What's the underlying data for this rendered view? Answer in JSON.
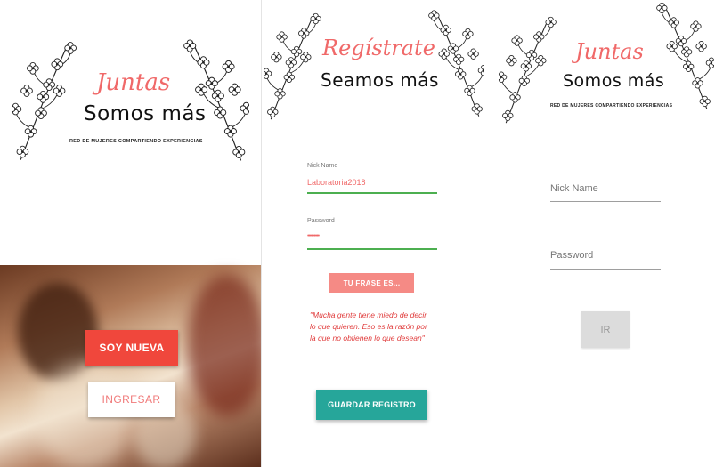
{
  "welcome": {
    "logo_script": "Juntas",
    "logo_main": "Somos más",
    "tagline": "RED DE MUJERES COMPARTIENDO EXPERIENCIAS",
    "new_button": "SOY NUEVA",
    "login_button": "INGRESAR"
  },
  "register": {
    "title_script": "Regístrate",
    "title_main": "Seamos más",
    "nick_label": "Nick Name",
    "nick_value": "Laboratoria2018",
    "password_label": "Password",
    "password_value": "•••••••••",
    "phrase_button": "TU FRASE ES...",
    "quote": "\"Mucha gente tiene miedo de decir lo que quieren. Eso es la razón por la que no obtienen lo que desean\"",
    "save_button": "GUARDAR REGISTRO"
  },
  "login": {
    "logo_script": "Juntas",
    "logo_main": "Somos más",
    "tagline": "RED DE MUJERES COMPARTIENDO EXPERIENCIAS",
    "nick_placeholder": "Nick Name",
    "password_placeholder": "Password",
    "submit_button": "IR"
  },
  "colors": {
    "accent_red": "#f0473c",
    "script_coral": "#f06969",
    "phrase_coral": "#f58a85",
    "teal": "#26a69a",
    "input_green": "#4caf50"
  },
  "icons": [
    "flower-branch-icon"
  ]
}
